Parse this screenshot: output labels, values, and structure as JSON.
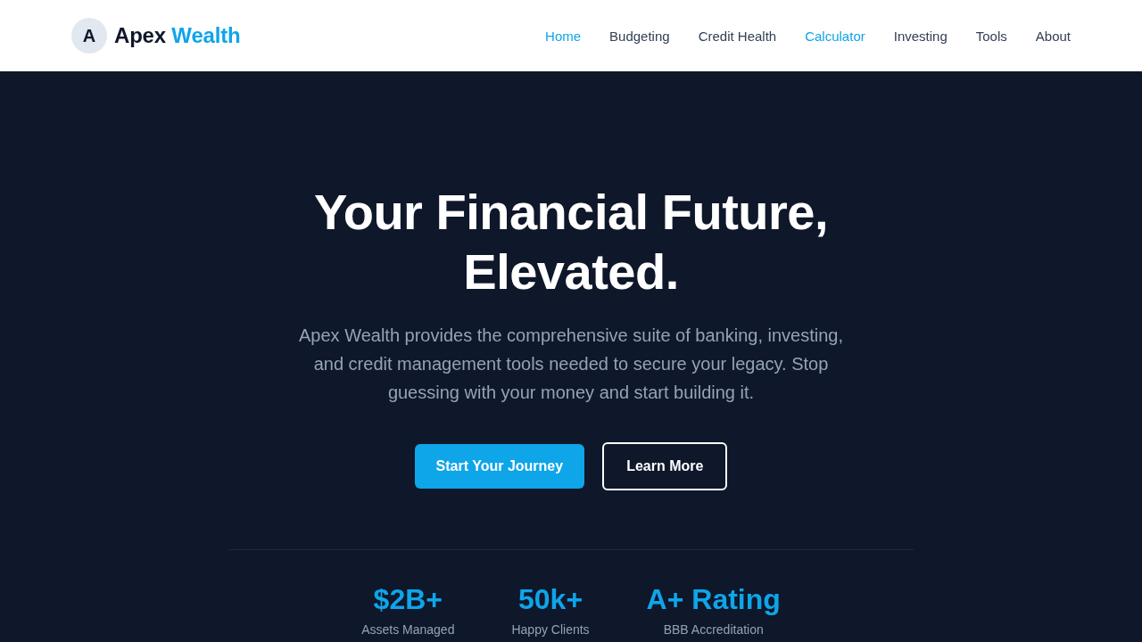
{
  "header": {
    "logo": {
      "mark": "A",
      "name": "Apex",
      "name_accent": "Wealth"
    },
    "nav": [
      {
        "label": "Home",
        "selected": true
      },
      {
        "label": "Budgeting",
        "selected": false
      },
      {
        "label": "Credit Health",
        "selected": false
      },
      {
        "label": "Calculator",
        "selected": true
      },
      {
        "label": "Investing",
        "selected": false
      },
      {
        "label": "Tools",
        "selected": false
      },
      {
        "label": "About",
        "selected": false
      }
    ]
  },
  "hero": {
    "title": "Your Financial Future, Elevated.",
    "subtitle": "Apex Wealth provides the comprehensive suite of banking, investing, and credit management tools needed to secure your legacy. Stop guessing with your money and start building it.",
    "buttons": [
      {
        "label": "Start Your Journey",
        "kind": "primary"
      },
      {
        "label": "Learn More",
        "kind": "outline"
      }
    ],
    "stats": [
      {
        "value": "$2B+",
        "label": "Assets Managed"
      },
      {
        "value": "50k+",
        "label": "Happy Clients"
      },
      {
        "value": "A+ Rating",
        "label": "BBB Accreditation"
      }
    ]
  }
}
